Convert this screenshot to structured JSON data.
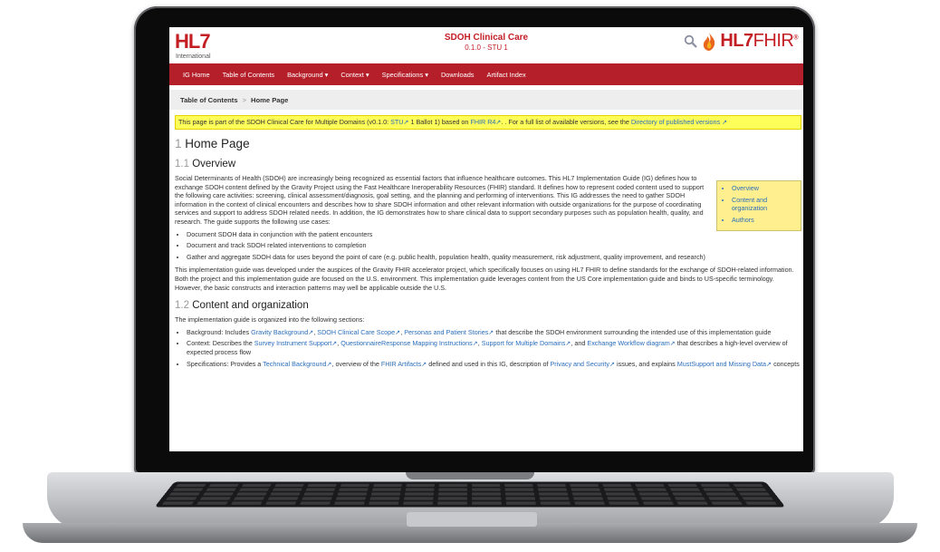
{
  "header": {
    "logo": "HL7",
    "logo_sub": "International",
    "ig_title": "SDOH Clinical Care",
    "ig_version": "0.1.0 - STU 1",
    "fhir_logo_hl7": "HL7",
    "fhir_logo_fhir": "FHIR",
    "fhir_reg": "®"
  },
  "nav": [
    "IG Home",
    "Table of Contents",
    "Background ▾",
    "Context ▾",
    "Specifications ▾",
    "Downloads",
    "Artifact Index"
  ],
  "breadcrumb": {
    "parent": "Table of Contents",
    "sep": ">",
    "current": "Home Page"
  },
  "notice": {
    "pre": "This page is part of the SDOH Clinical Care for Multiple Domains (v0.1.0: ",
    "stu_link": "STU",
    "mid1": " 1 Ballot 1) based on ",
    "fhir_link": "FHIR R4",
    "mid2": ". . For a full list of available versions, see the ",
    "dir_link": "Directory of published versions",
    "ext": "↗"
  },
  "page": {
    "title_num": "1",
    "title": "Home Page",
    "overview_num": "1.1",
    "overview": "Overview",
    "overview_p1": "Social Determinants of Health (SDOH) are increasingly being recognized as essential factors that influence healthcare outcomes. This HL7 Implementation Guide (IG) defines how to exchange SDOH content defined by the Gravity Project using the Fast Healthcare Ineroperability Resources (FHIR) standard. It defines how to represent coded content used to support the following care activities: screening, clinical assessment/diagnosis, goal setting, and the planning and performing of interventions. This IG addresses the need to gather SDOH information in the context of clinical encounters and describes how to share SDOH information and other relevant information with outside organizations for the purpose of coordinating services and support to address SDOH related needs. In addition, the IG demonstrates how to share clinical data to support secondary purposes such as population health, quality, and research. The guide supports the following use cases:",
    "use_cases": [
      "Document SDOH data in conjunction with the patient encounters",
      "Document and track SDOH related interventions to completion",
      "Gather and aggregate SDOH data for uses beyond the point of care (e.g. public health, population health, quality measurement, risk adjustment, quality improvement, and research)"
    ],
    "overview_p2": "This implementation guide was developed under the auspices of the Gravity FHIR accelerator project, which specifically focuses on using HL7 FHIR to define standards for the exchange of SDOH-related information. Both the project and this implementation guide are focused on the U.S. environment. This implementation guide leverages content from the US Core implementation guide and binds to US-specific terminology. However, the basic constructs and interaction patterns may well be applicable outside the U.S.",
    "content_num": "1.2",
    "content": "Content and organization",
    "content_p": "The implementation guide is organized into the following sections:",
    "sections": {
      "background": {
        "pre": "Background: Includes ",
        "l1": "Gravity Background",
        "l2": "SDOH Clinical Care Scope",
        "l3": "Personas and Patient Stories",
        "post": " that describe the SDOH environment surrounding the intended use of this implementation guide"
      },
      "context": {
        "pre": "Context: Describes the ",
        "l1": "Survey Instrument Support",
        "l2": "QuestionnaireResponse Mapping Instructions",
        "l3": "Support for Multiple Domains",
        "and": ", and ",
        "l4": "Exchange Workflow diagram",
        "post": " that describes a high-level overview of expected process flow"
      },
      "specs": {
        "pre": "Specifications: Provides a ",
        "l1": "Technical Background",
        "mid1": ", overview of the ",
        "l2": "FHIR Artifacts",
        "mid2": " defined and used in this IG, description of ",
        "l3": "Privacy and Security",
        "mid3": " issues, and explains ",
        "l4": "MustSupport and Missing Data",
        "post": " concepts"
      }
    }
  },
  "toc": [
    "Overview",
    "Content and organization",
    "Authors"
  ],
  "colors": {
    "brand": "#b51f2a",
    "notice": "#ffff59",
    "toc": "#ffef8f",
    "link": "#2a6ebb"
  }
}
